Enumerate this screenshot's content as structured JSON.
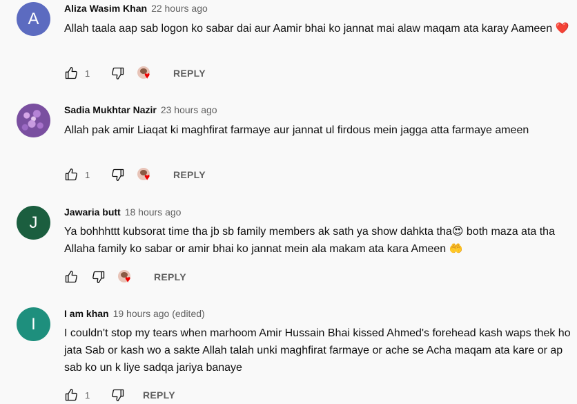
{
  "comments": [
    {
      "author": "Aliza Wasim Khan",
      "time": "22 hours ago",
      "avatar_letter": "A",
      "avatar_color": "#5c6bc0",
      "text": "Allah taala aap sab logon ko sabar dai aur Aamir bhai ko jannat mai alaw maqam ata karay Aameen ❤️",
      "likes": "1",
      "reply_label": "REPLY",
      "hearted": true
    },
    {
      "author": "Sadia Mukhtar Nazir",
      "time": "23 hours ago",
      "avatar_letter": "",
      "avatar_color": "#7a4fa0",
      "text": "Allah pak amir Liaqat ki maghfirat farmaye aur jannat ul firdous mein jagga atta farmaye ameen",
      "likes": "1",
      "reply_label": "REPLY",
      "hearted": true
    },
    {
      "author": "Jawaria butt",
      "time": "18 hours ago",
      "avatar_letter": "J",
      "avatar_color": "#1b5e3f",
      "text": "Ya bohhhttt kubsorat time tha jb sb family members ak sath ya show dahkta tha😍  both maza ata tha Allaha family ko sabar or amir bhai ko jannat mein ala makam ata kara Ameen 🤲",
      "likes": "",
      "reply_label": "REPLY",
      "hearted": true
    },
    {
      "author": "I am khan",
      "time": "19 hours ago (edited)",
      "avatar_letter": "I",
      "avatar_color": "#1e8f7d",
      "text": "I couldn't stop my tears when marhoom Amir Hussain Bhai kissed Ahmed's forehead kash waps thek ho jata Sab or kash wo a sakte Allah talah unki maghfirat farmaye or ache se Acha maqam ata kare or ap sab ko un k liye sadqa jariya banaye",
      "likes": "1",
      "reply_label": "REPLY",
      "hearted": false
    }
  ],
  "icons": {
    "like": "thumb-up-icon",
    "dislike": "thumb-down-icon",
    "heart": "heart-icon"
  }
}
